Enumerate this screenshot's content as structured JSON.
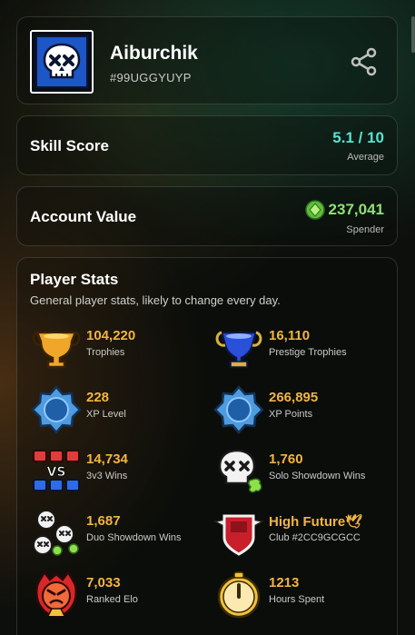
{
  "profile": {
    "name": "Aiburchik",
    "tag": "#99UGGYUYP",
    "avatar_icon": "skull-icon",
    "share_icon": "share-icon"
  },
  "skill": {
    "title": "Skill Score",
    "score": "5.1 / 10",
    "rating": "Average"
  },
  "account_value": {
    "title": "Account Value",
    "value": "237,041",
    "tier": "Spender",
    "icon": "gem-coin-icon"
  },
  "player_stats": {
    "title": "Player Stats",
    "subtitle": "General player stats, likely to change every day.",
    "items": [
      {
        "value": "104,220",
        "label": "Trophies",
        "icon": "trophy-icon"
      },
      {
        "value": "16,110",
        "label": "Prestige Trophies",
        "icon": "prestige-trophy-icon"
      },
      {
        "value": "228",
        "label": "XP Level",
        "icon": "xp-level-icon"
      },
      {
        "value": "266,895",
        "label": "XP Points",
        "icon": "xp-points-icon"
      },
      {
        "value": "14,734",
        "label": "3v3 Wins",
        "icon": "3v3-icon"
      },
      {
        "value": "1,760",
        "label": "Solo Showdown Wins",
        "icon": "solo-showdown-icon"
      },
      {
        "value": "1,687",
        "label": "Duo Showdown Wins",
        "icon": "duo-showdown-icon"
      },
      {
        "value": "High Future🕊",
        "label": "Club #2CC9GCGCC",
        "icon": "club-badge-icon"
      },
      {
        "value": "7,033",
        "label": "Ranked Elo",
        "icon": "ranked-icon"
      },
      {
        "value": "1213",
        "label": "Hours Spent",
        "icon": "clock-icon"
      }
    ]
  },
  "colors": {
    "accent_gold": "#f3b53f",
    "skill_teal": "#57e3d0",
    "value_green": "#8fe074"
  }
}
